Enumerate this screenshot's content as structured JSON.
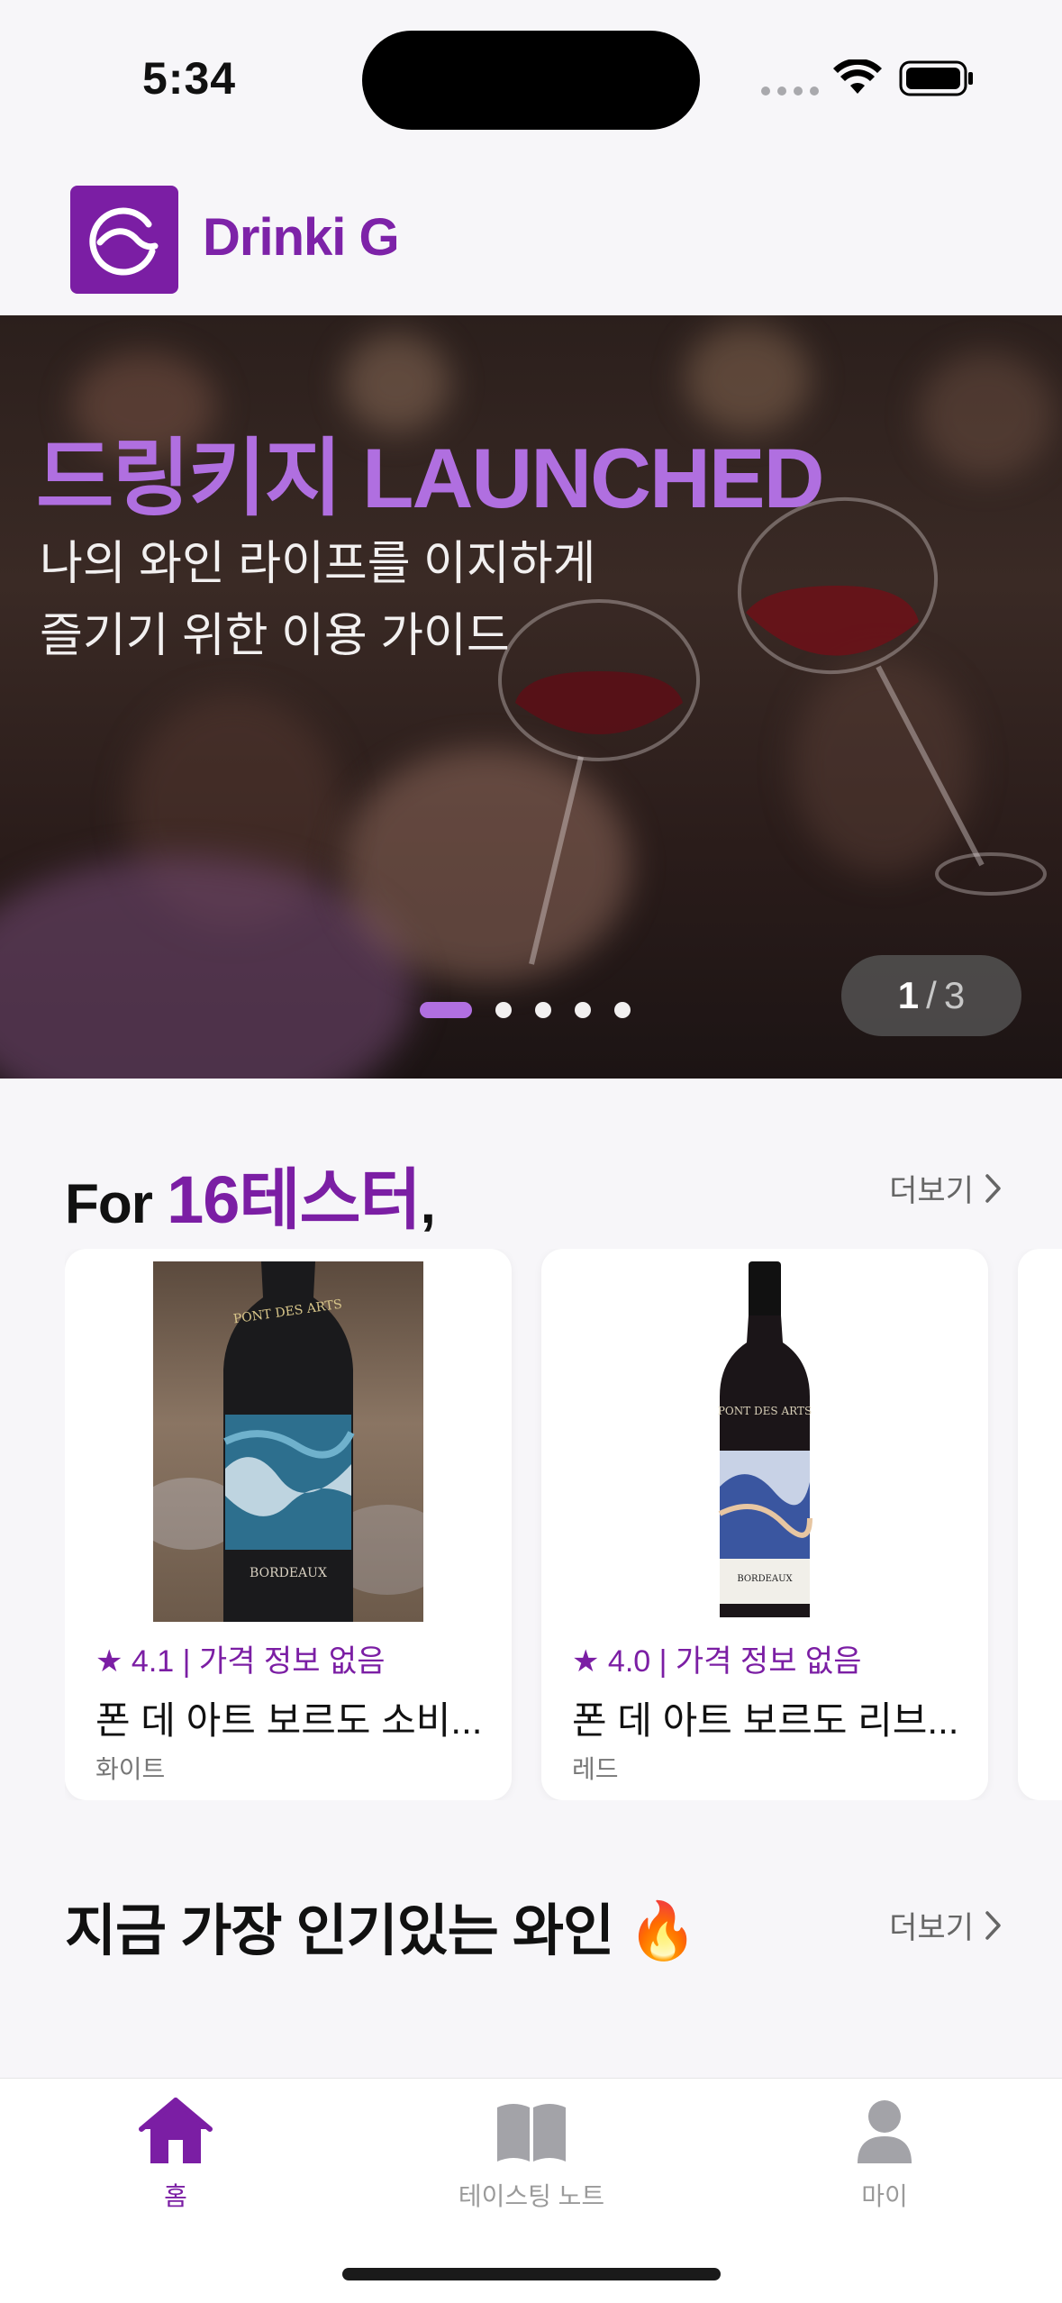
{
  "status": {
    "time": "5:34"
  },
  "app": {
    "brand": "Drinki G"
  },
  "banner": {
    "title": "드링키지 LAUNCHED",
    "subtitle_line1": "나의 와인 라이프를 이지하게",
    "subtitle_line2": "즐기기 위한 이용 가이드",
    "page_current": "1",
    "page_sep": "/",
    "page_total": "3"
  },
  "section_for": {
    "prefix": "For ",
    "name": "16테스터",
    "suffix": ",",
    "more": "더보기"
  },
  "cards": [
    {
      "meta": "★ 4.1  |  가격 정보 없음",
      "name": "폰 데 아트 보르도 소비...",
      "type": "화이트"
    },
    {
      "meta": "★ 4.0  |  가격 정보 없음",
      "name": "폰 데 아트 보르도 리브...",
      "type": "레드"
    }
  ],
  "section_popular": {
    "title": "지금 가장 인기있는 와인 ",
    "emoji": "🔥",
    "more": "더보기"
  },
  "tabs": [
    {
      "label": "홈",
      "icon": "home-icon",
      "active": true
    },
    {
      "label": "테이스팅 노트",
      "icon": "book-icon",
      "active": false
    },
    {
      "label": "마이",
      "icon": "person-icon",
      "active": false
    }
  ],
  "colors": {
    "accent": "#7b1ea4",
    "banner_title": "#b06fe0"
  }
}
